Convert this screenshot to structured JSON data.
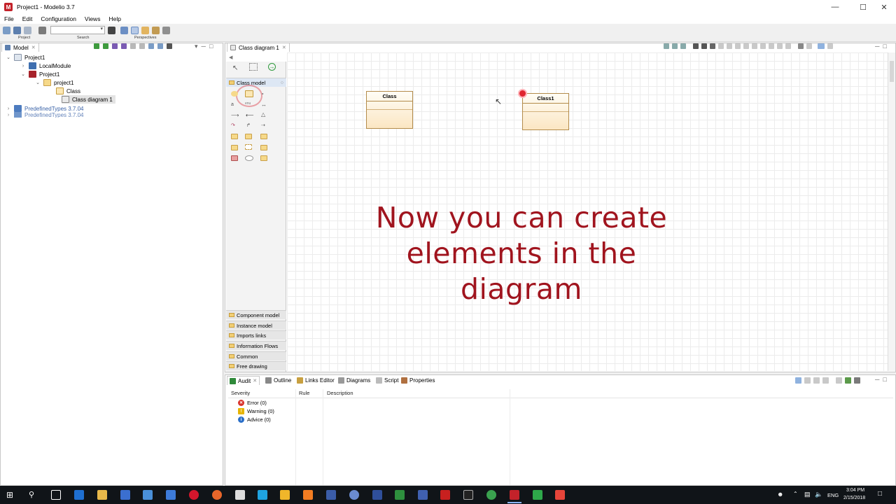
{
  "window": {
    "title": "Project1 - Modelio 3.7",
    "controls": [
      "—",
      "☐",
      "✕"
    ]
  },
  "menu": [
    "File",
    "Edit",
    "Configuration",
    "Views",
    "Help"
  ],
  "toolbar": {
    "groups": [
      "Project",
      "Search",
      "Perspectives"
    ]
  },
  "model_panel": {
    "tab_label": "Model",
    "tree": [
      {
        "label": "Project1",
        "icon": "project-icon",
        "toggle": "⌄"
      },
      {
        "label": "LocalModule",
        "icon": "module-icon",
        "toggle": "›"
      },
      {
        "label": "Project1",
        "icon": "project-package-icon",
        "toggle": "⌄"
      },
      {
        "label": "project1",
        "icon": "package-folder-icon",
        "toggle": "⌄"
      },
      {
        "label": "Class",
        "icon": "class-icon",
        "toggle": ""
      },
      {
        "label": "Class diagram 1",
        "icon": "class-diagram-icon",
        "toggle": ""
      },
      {
        "label": "PredefinedTypes 3.7.04",
        "icon": "predefined-types-icon",
        "toggle": "›"
      },
      {
        "label": "PredefinedTypes 3.7.04",
        "icon": "predefined-types-icon",
        "toggle": "›"
      }
    ]
  },
  "editor": {
    "tab_label": "Class diagram 1",
    "palette": {
      "active_category": "Class model",
      "categories": [
        "Component model",
        "Instance model",
        "Imports links",
        "Information Flows",
        "Common",
        "Free drawing"
      ]
    },
    "diagram": {
      "classes": [
        {
          "name": "Class"
        },
        {
          "name": "Class1"
        }
      ]
    },
    "overlay_text": [
      "Now you can create",
      "elements in the",
      "diagram"
    ]
  },
  "bottom_panel": {
    "tabs": [
      "Audit",
      "Outline",
      "Links Editor",
      "Diagrams",
      "Script",
      "Properties"
    ],
    "columns": [
      "Severity",
      "Rule",
      "Description"
    ],
    "rows": [
      {
        "label": "Error (0)",
        "icon": "error-icon",
        "color": "#d9322b",
        "glyph": "✕"
      },
      {
        "label": "Warning (0)",
        "icon": "warning-icon",
        "color": "#e6b400",
        "glyph": "!"
      },
      {
        "label": "Advice (0)",
        "icon": "info-icon",
        "color": "#2a6fc9",
        "glyph": "i"
      }
    ]
  },
  "taskbar": {
    "language": "ENG",
    "time": "3:04 PM",
    "date": "2/15/2018"
  },
  "colors": {
    "accent_red": "#a0141e",
    "class_border": "#b38b4a",
    "taskbar": "#101418"
  }
}
